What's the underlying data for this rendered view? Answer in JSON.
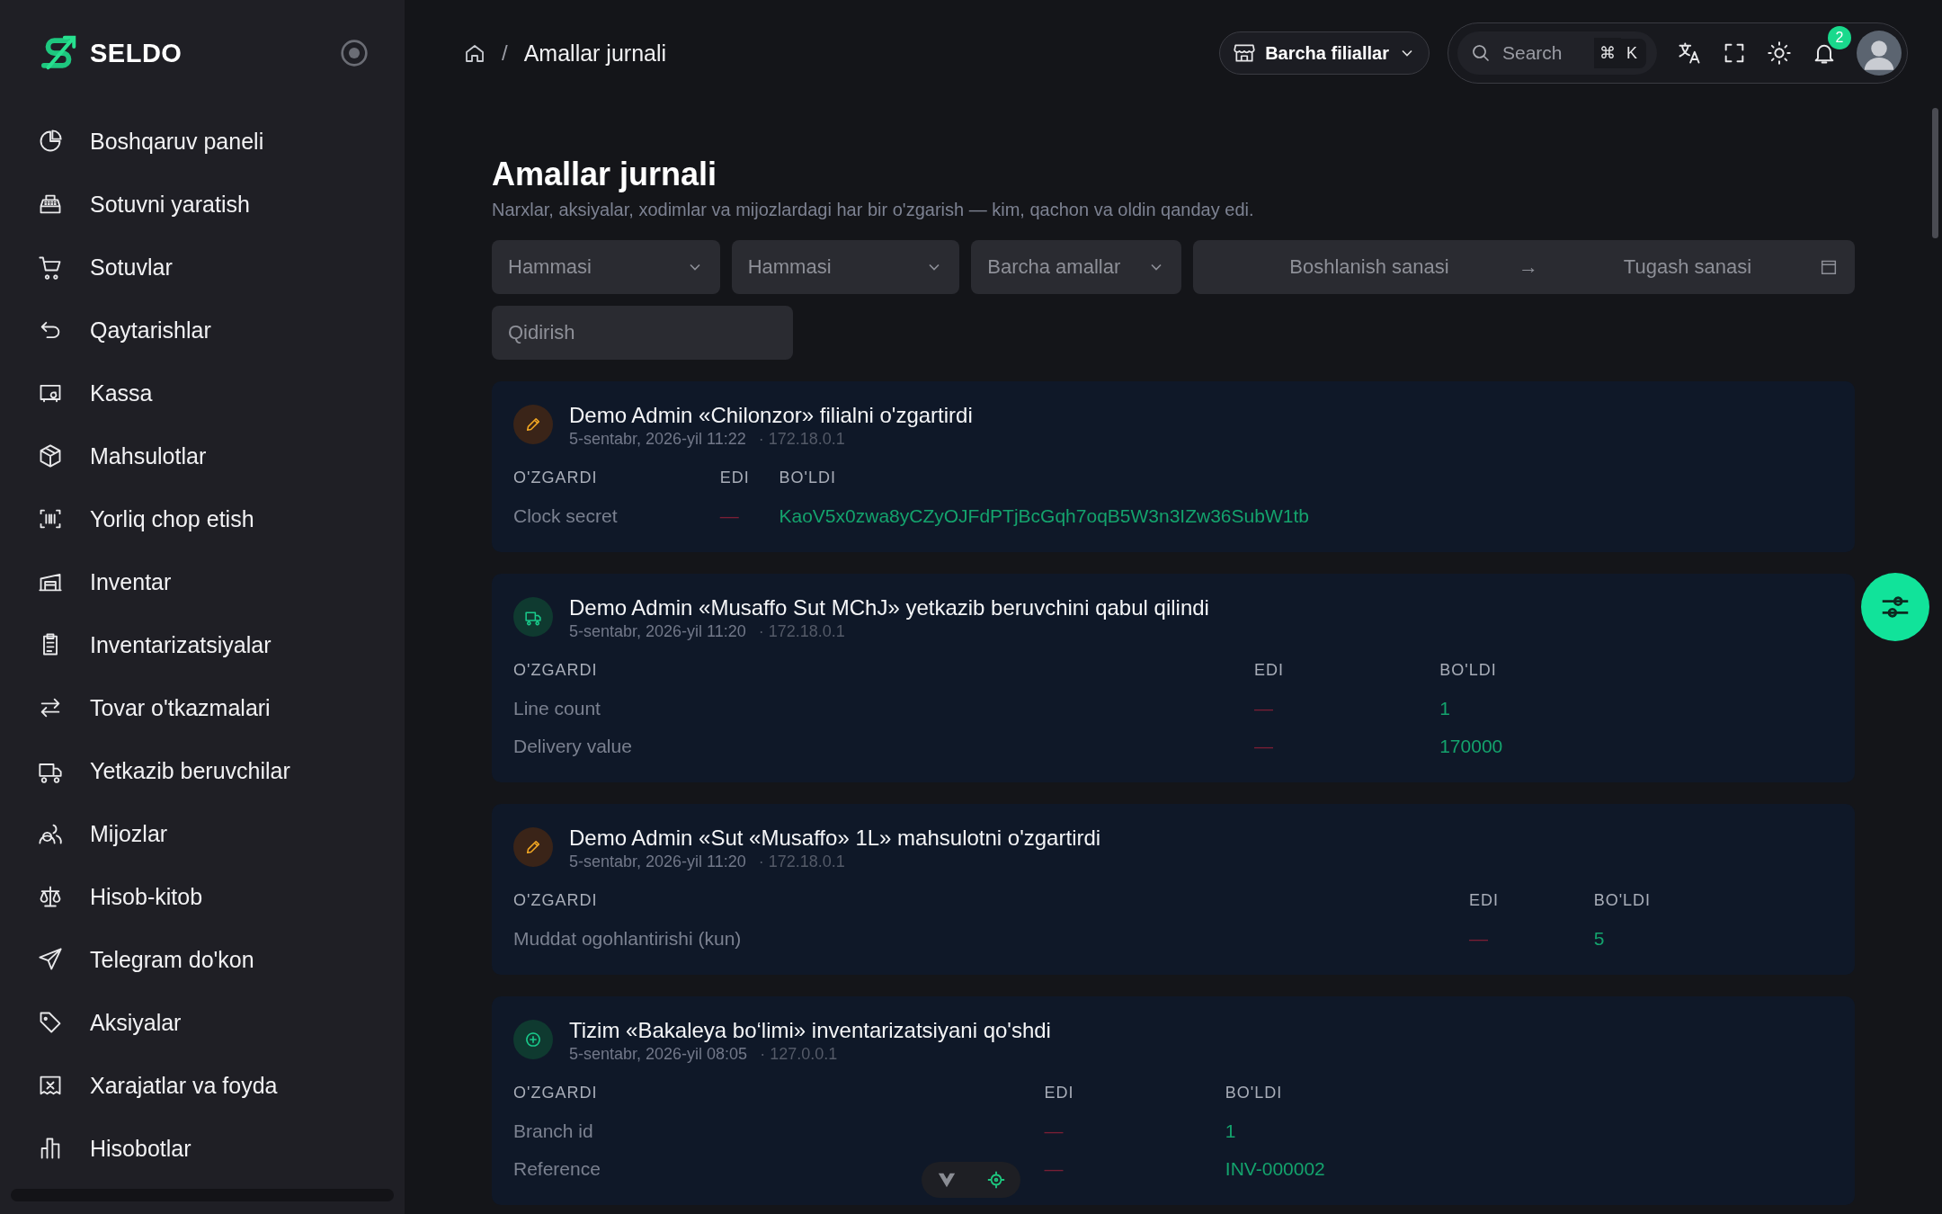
{
  "sidebar": {
    "brand": "SELDO",
    "items": [
      {
        "label": "Boshqaruv paneli"
      },
      {
        "label": "Sotuvni yaratish"
      },
      {
        "label": "Sotuvlar"
      },
      {
        "label": "Qaytarishlar"
      },
      {
        "label": "Kassa"
      },
      {
        "label": "Mahsulotlar"
      },
      {
        "label": "Yorliq chop etish"
      },
      {
        "label": "Inventar"
      },
      {
        "label": "Inventarizatsiyalar"
      },
      {
        "label": "Tovar o'tkazmalari"
      },
      {
        "label": "Yetkazib beruvchilar"
      },
      {
        "label": "Mijozlar"
      },
      {
        "label": "Hisob-kitob"
      },
      {
        "label": "Telegram do'kon"
      },
      {
        "label": "Aksiyalar"
      },
      {
        "label": "Xarajatlar va foyda"
      },
      {
        "label": "Hisobotlar"
      }
    ]
  },
  "topbar": {
    "breadcrumb": [
      "/",
      "Amallar jurnali"
    ],
    "branch": "Barcha filiallar",
    "search": {
      "placeholder": "Search",
      "keys": [
        "⌘",
        "K"
      ]
    },
    "notifications": "2"
  },
  "page": {
    "title": "Amallar jurnali",
    "subtitle": "Narxlar, aksiyalar, xodimlar va mijozlardagi har bir o'zgarish — kim, qachon va oldin qanday edi."
  },
  "filters": {
    "selects": [
      "Hammasi",
      "Hammasi",
      "Barcha amallar"
    ],
    "date_range": {
      "start_placeholder": "Boshlanish sanasi",
      "separator": "→",
      "end_placeholder": "Tugash sanasi"
    },
    "search": {
      "placeholder": "Qidirish"
    }
  },
  "entries": [
    {
      "kind": "edit",
      "title": "Demo Admin «Chilonzor» filialni o'zgartirdi",
      "date": "5-sentabr, 2026-yil 11:22",
      "ip": "· 172.18.0.1",
      "columns": [
        "O'ZGARDI",
        "EDI",
        "BO'LDI"
      ],
      "rows": [
        {
          "field": "Clock secret",
          "before": "—",
          "after": "KaoV5x0zwa8yCZyOJFdPTjBcGqh7oqB5W3n3IZw36SubW1tb"
        }
      ]
    },
    {
      "kind": "supplier",
      "title": "Demo Admin «Musaffo Sut MChJ» yetkazib beruvchini qabul qilindi",
      "date": "5-sentabr, 2026-yil 11:20",
      "ip": "· 172.18.0.1",
      "columns": [
        "O'ZGARDI",
        "EDI",
        "BO'LDI"
      ],
      "rows": [
        {
          "field": "Line count",
          "before": "—",
          "after": "1"
        },
        {
          "field": "Delivery value",
          "before": "—",
          "after": "170000"
        }
      ]
    },
    {
      "kind": "edit",
      "title": "Demo Admin «Sut «Musaffo» 1L» mahsulotni o'zgartirdi",
      "date": "5-sentabr, 2026-yil 11:20",
      "ip": "· 172.18.0.1",
      "columns": [
        "O'ZGARDI",
        "EDI",
        "BO'LDI"
      ],
      "rows": [
        {
          "field": "Muddat ogohlantirishi (kun)",
          "before": "—",
          "after": "5"
        }
      ]
    },
    {
      "kind": "add",
      "title": "Tizim «Bakaleya bo‘limi» inventarizatsiyani qo'shdi",
      "date": "5-sentabr, 2026-yil 08:05",
      "ip": "· 127.0.0.1",
      "columns": [
        "O'ZGARDI",
        "EDI",
        "BO'LDI"
      ],
      "rows": [
        {
          "field": "Branch id",
          "before": "—",
          "after": "1"
        },
        {
          "field": "Reference",
          "before": "—",
          "after": "INV-000002"
        }
      ]
    }
  ]
}
